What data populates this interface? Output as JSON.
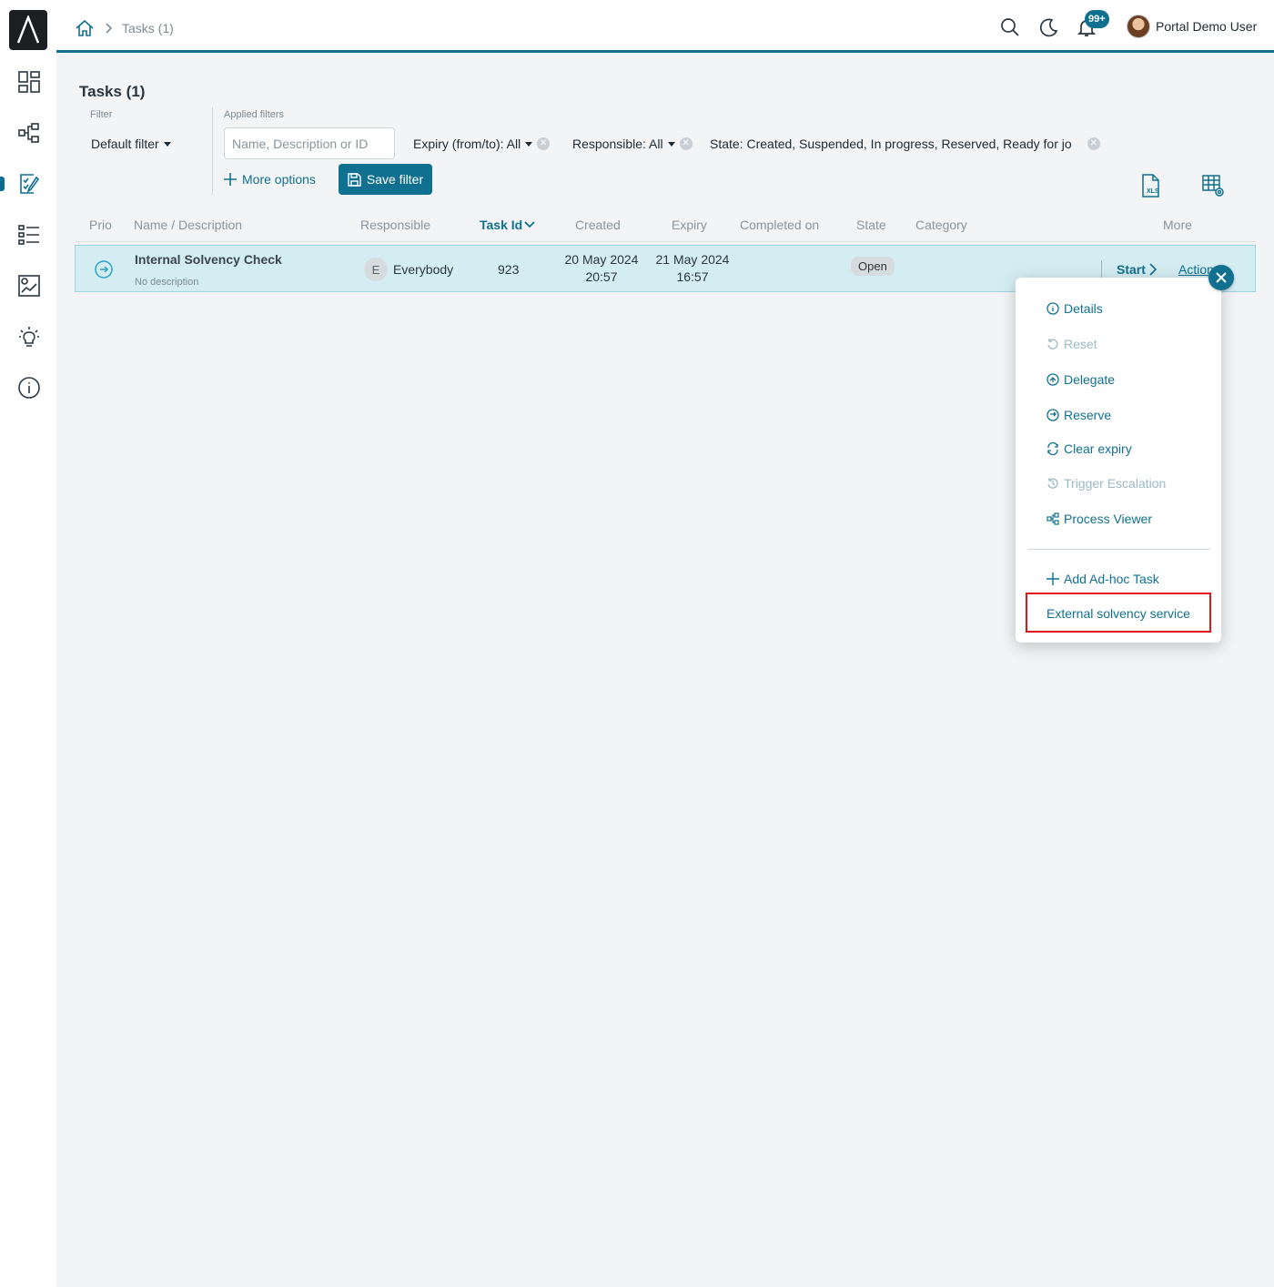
{
  "breadcrumb": {
    "current": "Tasks (1)"
  },
  "header": {
    "notification_badge": "99+",
    "user_name": "Portal Demo User"
  },
  "page": {
    "title": "Tasks (1)"
  },
  "filters": {
    "filter_label": "Filter",
    "applied_label": "Applied filters",
    "default_filter": "Default filter",
    "search_placeholder": "Name, Description or ID",
    "chips": [
      {
        "label": "Expiry (from/to): All"
      },
      {
        "label": "Responsible: All"
      },
      {
        "label": "State: Created, Suspended, In progress, Reserved, Ready for jo"
      }
    ],
    "more_options": "More options",
    "save_filter": "Save filter"
  },
  "table": {
    "columns": [
      "Prio",
      "Name / Description",
      "Responsible",
      "Task Id",
      "Created",
      "Expiry",
      "Completed on",
      "State",
      "Category",
      "More"
    ],
    "rows": [
      {
        "name": "Internal Solvency Check",
        "description": "No description",
        "responsible_initial": "E",
        "responsible": "Everybody",
        "task_id": "923",
        "created_date": "20 May 2024",
        "created_time": "20:57",
        "expiry_date": "21 May 2024",
        "expiry_time": "16:57",
        "state": "Open",
        "start": "Start",
        "actions": "Actions"
      }
    ]
  },
  "menu": {
    "items": [
      {
        "label": "Details",
        "icon": "info-icon",
        "disabled": false
      },
      {
        "label": "Reset",
        "icon": "reset-icon",
        "disabled": true
      },
      {
        "label": "Delegate",
        "icon": "delegate-icon",
        "disabled": false
      },
      {
        "label": "Reserve",
        "icon": "reserve-icon",
        "disabled": false
      },
      {
        "label": "Clear expiry",
        "icon": "refresh-icon",
        "disabled": false
      },
      {
        "label": "Trigger Escalation",
        "icon": "history-icon",
        "disabled": true
      },
      {
        "label": "Process Viewer",
        "icon": "process-icon",
        "disabled": false
      }
    ],
    "add_adhoc": "Add Ad-hoc Task",
    "external": "External solvency service"
  },
  "colors": {
    "accent": "#10708f",
    "row_highlight": "#d4edf3",
    "highlight_box": "#e0181e"
  }
}
